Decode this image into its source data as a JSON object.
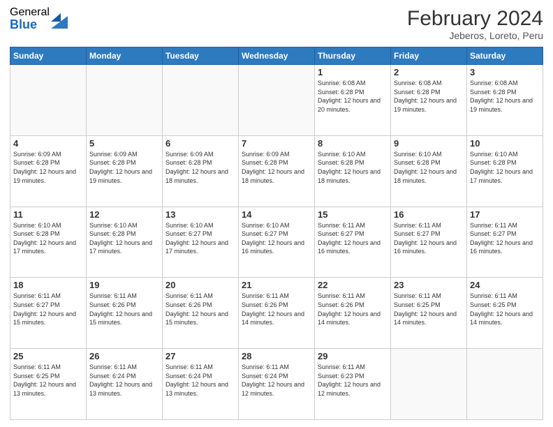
{
  "logo": {
    "general": "General",
    "blue": "Blue"
  },
  "title": "February 2024",
  "location": "Jeberos, Loreto, Peru",
  "days_of_week": [
    "Sunday",
    "Monday",
    "Tuesday",
    "Wednesday",
    "Thursday",
    "Friday",
    "Saturday"
  ],
  "weeks": [
    [
      {
        "day": "",
        "info": ""
      },
      {
        "day": "",
        "info": ""
      },
      {
        "day": "",
        "info": ""
      },
      {
        "day": "",
        "info": ""
      },
      {
        "day": "1",
        "info": "Sunrise: 6:08 AM\nSunset: 6:28 PM\nDaylight: 12 hours\nand 20 minutes."
      },
      {
        "day": "2",
        "info": "Sunrise: 6:08 AM\nSunset: 6:28 PM\nDaylight: 12 hours\nand 19 minutes."
      },
      {
        "day": "3",
        "info": "Sunrise: 6:08 AM\nSunset: 6:28 PM\nDaylight: 12 hours\nand 19 minutes."
      }
    ],
    [
      {
        "day": "4",
        "info": "Sunrise: 6:09 AM\nSunset: 6:28 PM\nDaylight: 12 hours\nand 19 minutes."
      },
      {
        "day": "5",
        "info": "Sunrise: 6:09 AM\nSunset: 6:28 PM\nDaylight: 12 hours\nand 19 minutes."
      },
      {
        "day": "6",
        "info": "Sunrise: 6:09 AM\nSunset: 6:28 PM\nDaylight: 12 hours\nand 18 minutes."
      },
      {
        "day": "7",
        "info": "Sunrise: 6:09 AM\nSunset: 6:28 PM\nDaylight: 12 hours\nand 18 minutes."
      },
      {
        "day": "8",
        "info": "Sunrise: 6:10 AM\nSunset: 6:28 PM\nDaylight: 12 hours\nand 18 minutes."
      },
      {
        "day": "9",
        "info": "Sunrise: 6:10 AM\nSunset: 6:28 PM\nDaylight: 12 hours\nand 18 minutes."
      },
      {
        "day": "10",
        "info": "Sunrise: 6:10 AM\nSunset: 6:28 PM\nDaylight: 12 hours\nand 17 minutes."
      }
    ],
    [
      {
        "day": "11",
        "info": "Sunrise: 6:10 AM\nSunset: 6:28 PM\nDaylight: 12 hours\nand 17 minutes."
      },
      {
        "day": "12",
        "info": "Sunrise: 6:10 AM\nSunset: 6:28 PM\nDaylight: 12 hours\nand 17 minutes."
      },
      {
        "day": "13",
        "info": "Sunrise: 6:10 AM\nSunset: 6:27 PM\nDaylight: 12 hours\nand 17 minutes."
      },
      {
        "day": "14",
        "info": "Sunrise: 6:10 AM\nSunset: 6:27 PM\nDaylight: 12 hours\nand 16 minutes."
      },
      {
        "day": "15",
        "info": "Sunrise: 6:11 AM\nSunset: 6:27 PM\nDaylight: 12 hours\nand 16 minutes."
      },
      {
        "day": "16",
        "info": "Sunrise: 6:11 AM\nSunset: 6:27 PM\nDaylight: 12 hours\nand 16 minutes."
      },
      {
        "day": "17",
        "info": "Sunrise: 6:11 AM\nSunset: 6:27 PM\nDaylight: 12 hours\nand 16 minutes."
      }
    ],
    [
      {
        "day": "18",
        "info": "Sunrise: 6:11 AM\nSunset: 6:27 PM\nDaylight: 12 hours\nand 15 minutes."
      },
      {
        "day": "19",
        "info": "Sunrise: 6:11 AM\nSunset: 6:26 PM\nDaylight: 12 hours\nand 15 minutes."
      },
      {
        "day": "20",
        "info": "Sunrise: 6:11 AM\nSunset: 6:26 PM\nDaylight: 12 hours\nand 15 minutes."
      },
      {
        "day": "21",
        "info": "Sunrise: 6:11 AM\nSunset: 6:26 PM\nDaylight: 12 hours\nand 14 minutes."
      },
      {
        "day": "22",
        "info": "Sunrise: 6:11 AM\nSunset: 6:26 PM\nDaylight: 12 hours\nand 14 minutes."
      },
      {
        "day": "23",
        "info": "Sunrise: 6:11 AM\nSunset: 6:25 PM\nDaylight: 12 hours\nand 14 minutes."
      },
      {
        "day": "24",
        "info": "Sunrise: 6:11 AM\nSunset: 6:25 PM\nDaylight: 12 hours\nand 14 minutes."
      }
    ],
    [
      {
        "day": "25",
        "info": "Sunrise: 6:11 AM\nSunset: 6:25 PM\nDaylight: 12 hours\nand 13 minutes."
      },
      {
        "day": "26",
        "info": "Sunrise: 6:11 AM\nSunset: 6:24 PM\nDaylight: 12 hours\nand 13 minutes."
      },
      {
        "day": "27",
        "info": "Sunrise: 6:11 AM\nSunset: 6:24 PM\nDaylight: 12 hours\nand 13 minutes."
      },
      {
        "day": "28",
        "info": "Sunrise: 6:11 AM\nSunset: 6:24 PM\nDaylight: 12 hours\nand 12 minutes."
      },
      {
        "day": "29",
        "info": "Sunrise: 6:11 AM\nSunset: 6:23 PM\nDaylight: 12 hours\nand 12 minutes."
      },
      {
        "day": "",
        "info": ""
      },
      {
        "day": "",
        "info": ""
      }
    ]
  ]
}
